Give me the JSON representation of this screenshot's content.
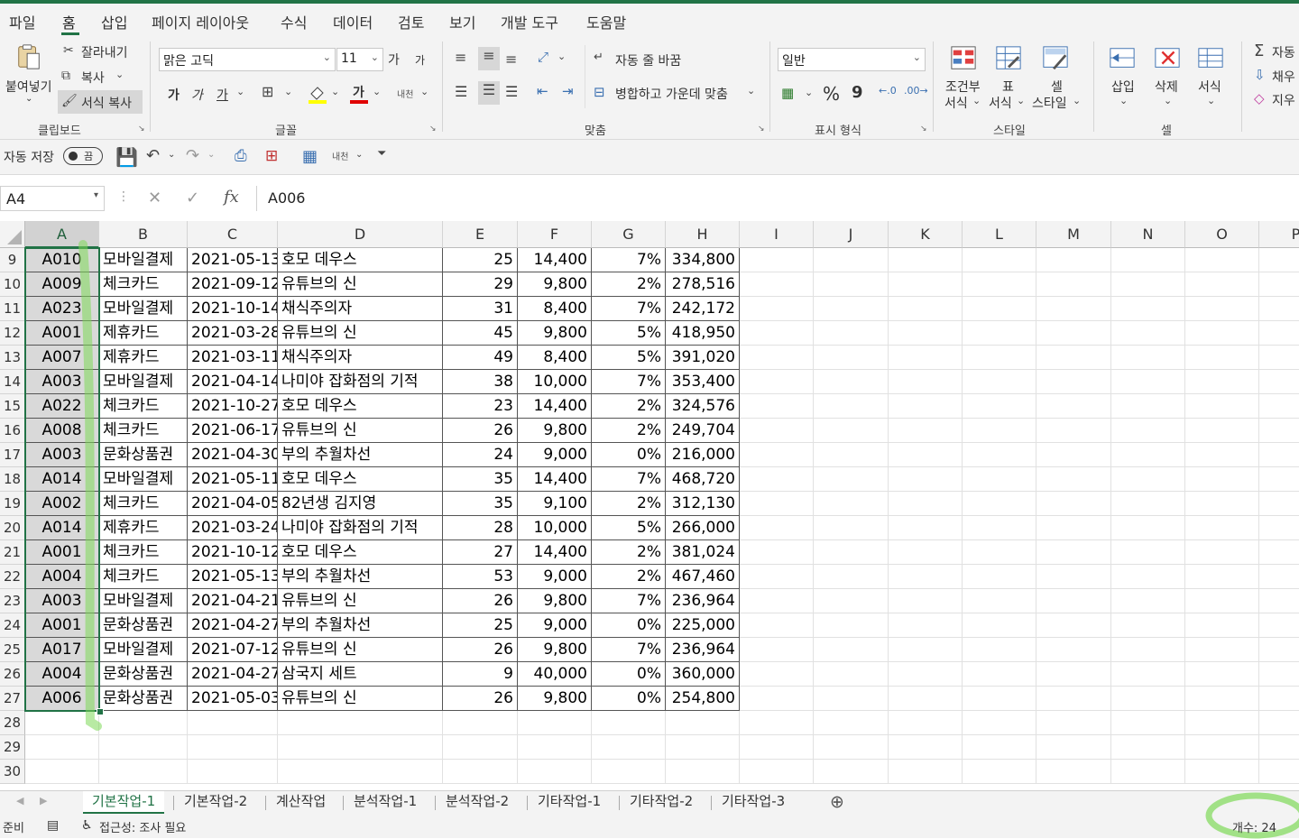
{
  "menu": [
    "파일",
    "홈",
    "삽입",
    "페이지 레이아웃",
    "수식",
    "데이터",
    "검토",
    "보기",
    "개발 도구",
    "도움말"
  ],
  "ribbon": {
    "paste_label": "붙여넣기",
    "cut_label": "잘라내기",
    "copy_label": "복사",
    "format_painter_label": "서식 복사",
    "clipboard_group": "클립보드",
    "font_name": "맑은 고딕",
    "font_size": "11",
    "grow_font": "가",
    "shrink_font": "가",
    "bold": "가",
    "italic": "가",
    "underline": "가",
    "phonetic": "내천",
    "font_group": "글꼴",
    "wrap_text_label": "자동 줄 바꿈",
    "merge_center_label": "병합하고 가운데 맞춤",
    "alignment_group": "맞춤",
    "number_format": "일반",
    "percent": "%",
    "comma": "9",
    "number_group": "표시 형식",
    "cond_format_label": "조건부",
    "cond_format_label2": "서식",
    "table_format_label": "표",
    "table_format_label2": "서식",
    "cell_style_label": "셀",
    "cell_style_label2": "스타일",
    "styles_group": "스타일",
    "insert_label": "삽입",
    "delete_label": "삭제",
    "format_label": "서식",
    "cells_group": "셀",
    "autosum_label": "자동",
    "fill_label": "채우",
    "clear_label": "지우"
  },
  "qat": {
    "autosave_label": "자동 저장",
    "autosave_state": "끔",
    "phonetic": "내천"
  },
  "formula_bar": {
    "name_box": "A4",
    "fx": "fx",
    "content": "A006"
  },
  "columns": [
    "A",
    "B",
    "C",
    "D",
    "E",
    "F",
    "G",
    "H",
    "I",
    "J",
    "K",
    "L",
    "M",
    "N",
    "O",
    "P"
  ],
  "rows": [
    {
      "n": "9",
      "a": "A010",
      "b": "모바일결제",
      "c": "2021-05-13",
      "d": "호모 데우스",
      "e": "25",
      "f": "14,400",
      "g": "7%",
      "h": "334,800"
    },
    {
      "n": "10",
      "a": "A009",
      "b": "체크카드",
      "c": "2021-09-12",
      "d": "유튜브의 신",
      "e": "29",
      "f": "9,800",
      "g": "2%",
      "h": "278,516"
    },
    {
      "n": "11",
      "a": "A023",
      "b": "모바일결제",
      "c": "2021-10-14",
      "d": "채식주의자",
      "e": "31",
      "f": "8,400",
      "g": "7%",
      "h": "242,172"
    },
    {
      "n": "12",
      "a": "A001",
      "b": "제휴카드",
      "c": "2021-03-28",
      "d": "유튜브의 신",
      "e": "45",
      "f": "9,800",
      "g": "5%",
      "h": "418,950"
    },
    {
      "n": "13",
      "a": "A007",
      "b": "제휴카드",
      "c": "2021-03-11",
      "d": "채식주의자",
      "e": "49",
      "f": "8,400",
      "g": "5%",
      "h": "391,020"
    },
    {
      "n": "14",
      "a": "A003",
      "b": "모바일결제",
      "c": "2021-04-14",
      "d": "나미야 잡화점의 기적",
      "e": "38",
      "f": "10,000",
      "g": "7%",
      "h": "353,400"
    },
    {
      "n": "15",
      "a": "A022",
      "b": "체크카드",
      "c": "2021-10-27",
      "d": "호모 데우스",
      "e": "23",
      "f": "14,400",
      "g": "2%",
      "h": "324,576"
    },
    {
      "n": "16",
      "a": "A008",
      "b": "체크카드",
      "c": "2021-06-17",
      "d": "유튜브의 신",
      "e": "26",
      "f": "9,800",
      "g": "2%",
      "h": "249,704"
    },
    {
      "n": "17",
      "a": "A003",
      "b": "문화상품권",
      "c": "2021-04-30",
      "d": "부의 추월차선",
      "e": "24",
      "f": "9,000",
      "g": "0%",
      "h": "216,000"
    },
    {
      "n": "18",
      "a": "A014",
      "b": "모바일결제",
      "c": "2021-05-11",
      "d": "호모 데우스",
      "e": "35",
      "f": "14,400",
      "g": "7%",
      "h": "468,720"
    },
    {
      "n": "19",
      "a": "A002",
      "b": "체크카드",
      "c": "2021-04-05",
      "d": "82년생 김지영",
      "e": "35",
      "f": "9,100",
      "g": "2%",
      "h": "312,130"
    },
    {
      "n": "20",
      "a": "A014",
      "b": "제휴카드",
      "c": "2021-03-24",
      "d": "나미야 잡화점의 기적",
      "e": "28",
      "f": "10,000",
      "g": "5%",
      "h": "266,000"
    },
    {
      "n": "21",
      "a": "A001",
      "b": "체크카드",
      "c": "2021-10-12",
      "d": "호모 데우스",
      "e": "27",
      "f": "14,400",
      "g": "2%",
      "h": "381,024"
    },
    {
      "n": "22",
      "a": "A004",
      "b": "체크카드",
      "c": "2021-05-13",
      "d": "부의 추월차선",
      "e": "53",
      "f": "9,000",
      "g": "2%",
      "h": "467,460"
    },
    {
      "n": "23",
      "a": "A003",
      "b": "모바일결제",
      "c": "2021-04-21",
      "d": "유튜브의 신",
      "e": "26",
      "f": "9,800",
      "g": "7%",
      "h": "236,964"
    },
    {
      "n": "24",
      "a": "A001",
      "b": "문화상품권",
      "c": "2021-04-27",
      "d": "부의 추월차선",
      "e": "25",
      "f": "9,000",
      "g": "0%",
      "h": "225,000"
    },
    {
      "n": "25",
      "a": "A017",
      "b": "모바일결제",
      "c": "2021-07-12",
      "d": "유튜브의 신",
      "e": "26",
      "f": "9,800",
      "g": "7%",
      "h": "236,964"
    },
    {
      "n": "26",
      "a": "A004",
      "b": "문화상품권",
      "c": "2021-04-27",
      "d": "삼국지 세트",
      "e": "9",
      "f": "40,000",
      "g": "0%",
      "h": "360,000"
    },
    {
      "n": "27",
      "a": "A006",
      "b": "문화상품권",
      "c": "2021-05-03",
      "d": "유튜브의 신",
      "e": "26",
      "f": "9,800",
      "g": "0%",
      "h": "254,800"
    }
  ],
  "empty_rows": [
    "28",
    "29",
    "30"
  ],
  "sheets": [
    "기본작업-1",
    "기본작업-2",
    "계산작업",
    "분석작업-1",
    "분석작업-2",
    "기타작업-1",
    "기타작업-2",
    "기타작업-3"
  ],
  "status": {
    "ready": "준비",
    "accessibility": "접근성: 조사 필요",
    "count": "개수: 24"
  },
  "colors": {
    "accent": "#217346",
    "highlight_mark": "#7ed957",
    "selected_cell": "#d9d9d9"
  }
}
